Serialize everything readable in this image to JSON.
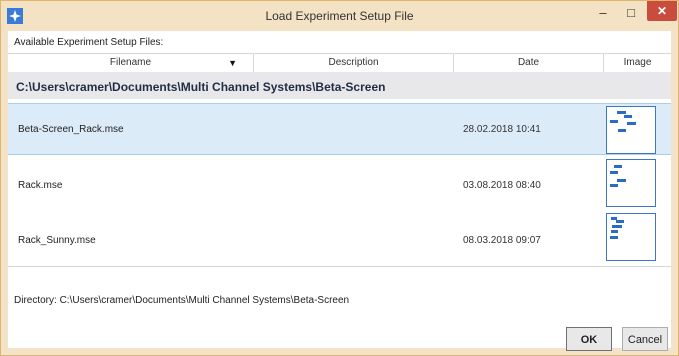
{
  "window": {
    "title": "Load Experiment Setup File"
  },
  "titlebar": {
    "minimize": "–",
    "maximize": "□",
    "close": "✕"
  },
  "available_label": "Available Experiment Setup Files:",
  "columns": {
    "filename": "Filename",
    "description": "Description",
    "date": "Date",
    "image": "Image"
  },
  "group": {
    "path": "C:\\Users\\cramer\\Documents\\Multi Channel Systems\\Beta-Screen"
  },
  "rows": [
    {
      "filename": "Beta-Screen_Rack.mse",
      "description": "",
      "date": "28.02.2018 10:41",
      "selected": true
    },
    {
      "filename": "Rack.mse",
      "description": "",
      "date": "03.08.2018 08:40",
      "selected": false
    },
    {
      "filename": "Rack_Sunny.mse",
      "description": "",
      "date": "08.03.2018 09:07",
      "selected": false
    }
  ],
  "directory": {
    "label": "Directory:",
    "path": "C:\\Users\\cramer\\Documents\\Multi Channel Systems\\Beta-Screen"
  },
  "buttons": {
    "ok": "OK",
    "cancel": "Cancel"
  },
  "colors": {
    "accent": "#2a6bc4",
    "frame": "#f3e2c3",
    "close": "#c94c3e",
    "selection": "#dcebf8"
  }
}
